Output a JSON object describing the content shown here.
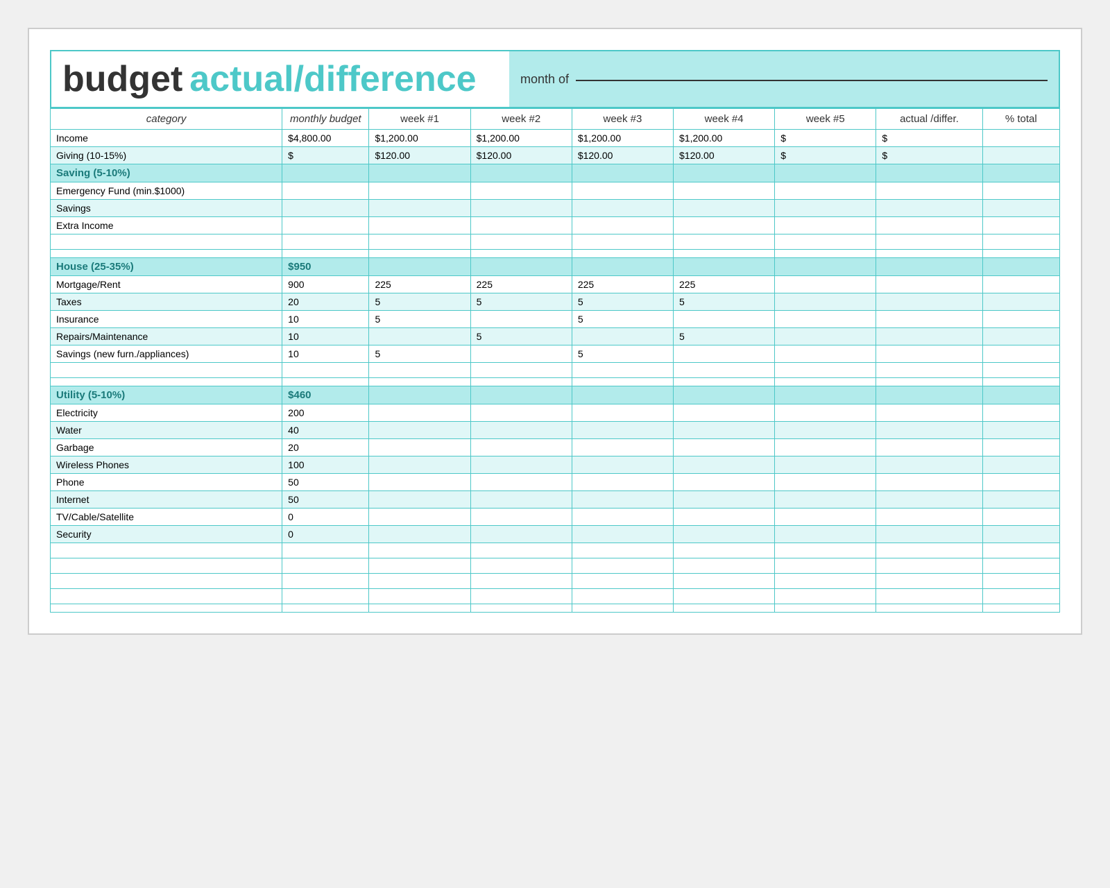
{
  "header": {
    "budget_label": "budget",
    "actual_label": "actual/difference",
    "month_of_label": "month of"
  },
  "columns": {
    "category": "category",
    "monthly_budget": "monthly budget",
    "week1": "week #1",
    "week2": "week #2",
    "week3": "week #3",
    "week4": "week #4",
    "week5": "week #5",
    "actual_differ": "actual /differ.",
    "pct_total": "% total"
  },
  "sections": [
    {
      "id": "income",
      "rows": [
        {
          "category": "Income",
          "monthly": "$4,800.00",
          "w1": "$1,200.00",
          "w2": "$1,200.00",
          "w3": "$1,200.00",
          "w4": "$1,200.00",
          "w5": "$",
          "actual": "$",
          "pct": ""
        },
        {
          "category": "Giving (10-15%)",
          "monthly": "$",
          "w1": "$120.00",
          "w2": "$120.00",
          "w3": "$120.00",
          "w4": "$120.00",
          "w5": "$",
          "actual": "$",
          "pct": ""
        }
      ]
    },
    {
      "id": "saving",
      "header": "Saving (5-10%)",
      "rows": [
        {
          "category": "Emergency Fund (min.$1000)",
          "monthly": "",
          "w1": "",
          "w2": "",
          "w3": "",
          "w4": "",
          "w5": "",
          "actual": "",
          "pct": ""
        },
        {
          "category": "Savings",
          "monthly": "",
          "w1": "",
          "w2": "",
          "w3": "",
          "w4": "",
          "w5": "",
          "actual": "",
          "pct": ""
        },
        {
          "category": "Extra Income",
          "monthly": "",
          "w1": "",
          "w2": "",
          "w3": "",
          "w4": "",
          "w5": "",
          "actual": "",
          "pct": ""
        }
      ]
    },
    {
      "id": "house",
      "header": "House (25-35%)",
      "header_monthly": "$950",
      "rows": [
        {
          "category": "Mortgage/Rent",
          "monthly": "900",
          "w1": "225",
          "w2": "225",
          "w3": "225",
          "w4": "225",
          "w5": "",
          "actual": "",
          "pct": ""
        },
        {
          "category": "Taxes",
          "monthly": "20",
          "w1": "5",
          "w2": "5",
          "w3": "5",
          "w4": "5",
          "w5": "",
          "actual": "",
          "pct": ""
        },
        {
          "category": "Insurance",
          "monthly": "10",
          "w1": "5",
          "w2": "",
          "w3": "5",
          "w4": "",
          "w5": "",
          "actual": "",
          "pct": ""
        },
        {
          "category": "Repairs/Maintenance",
          "monthly": "10",
          "w1": "",
          "w2": "5",
          "w3": "",
          "w4": "5",
          "w5": "",
          "actual": "",
          "pct": ""
        },
        {
          "category": "Savings (new furn./appliances)",
          "monthly": "10",
          "w1": "5",
          "w2": "",
          "w3": "5",
          "w4": "",
          "w5": "",
          "actual": "",
          "pct": ""
        }
      ]
    },
    {
      "id": "utility",
      "header": "Utility (5-10%)",
      "header_monthly": "$460",
      "rows": [
        {
          "category": "Electricity",
          "monthly": "200",
          "w1": "",
          "w2": "",
          "w3": "",
          "w4": "",
          "w5": "",
          "actual": "",
          "pct": ""
        },
        {
          "category": "Water",
          "monthly": "40",
          "w1": "",
          "w2": "",
          "w3": "",
          "w4": "",
          "w5": "",
          "actual": "",
          "pct": ""
        },
        {
          "category": "Garbage",
          "monthly": "20",
          "w1": "",
          "w2": "",
          "w3": "",
          "w4": "",
          "w5": "",
          "actual": "",
          "pct": ""
        },
        {
          "category": "Wireless Phones",
          "monthly": "100",
          "w1": "",
          "w2": "",
          "w3": "",
          "w4": "",
          "w5": "",
          "actual": "",
          "pct": ""
        },
        {
          "category": "Phone",
          "monthly": "50",
          "w1": "",
          "w2": "",
          "w3": "",
          "w4": "",
          "w5": "",
          "actual": "",
          "pct": ""
        },
        {
          "category": "Internet",
          "monthly": "50",
          "w1": "",
          "w2": "",
          "w3": "",
          "w4": "",
          "w5": "",
          "actual": "",
          "pct": ""
        },
        {
          "category": "TV/Cable/Satellite",
          "monthly": "0",
          "w1": "",
          "w2": "",
          "w3": "",
          "w4": "",
          "w5": "",
          "actual": "",
          "pct": ""
        },
        {
          "category": "Security",
          "monthly": "0",
          "w1": "",
          "w2": "",
          "w3": "",
          "w4": "",
          "w5": "",
          "actual": "",
          "pct": ""
        }
      ]
    }
  ],
  "extra_empty_rows": 4,
  "bottom_spacer": true
}
